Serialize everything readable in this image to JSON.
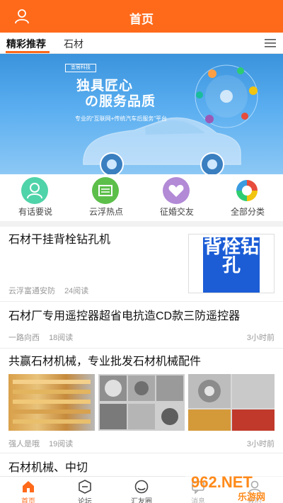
{
  "header": {
    "title": "首页",
    "user_icon": "user-icon"
  },
  "tabs": [
    {
      "label": "精彩推荐",
      "active": true
    },
    {
      "label": "石材",
      "active": false
    }
  ],
  "tabs_menu_icon": "menu-icon",
  "banner": {
    "logo_text": "宜居科技",
    "headline": "独具匠心",
    "subline": "の服务品质",
    "tagline": "专业的“互联网+传统汽车后服务”平台"
  },
  "quick_links": [
    {
      "label": "有话要说",
      "icon": "person-icon",
      "color": "#4fd3a8"
    },
    {
      "label": "云浮热点",
      "icon": "news-icon",
      "color": "#5cbf4a"
    },
    {
      "label": "征婚交友",
      "icon": "heart-handshake-icon",
      "color": "#b28ad6"
    },
    {
      "label": "全部分类",
      "icon": "swirl-icon",
      "color": "#3a9be0"
    }
  ],
  "articles": [
    {
      "title": "石材干挂背栓钻孔机",
      "author": "云浮富通安防",
      "reads": "24阅读",
      "time": "",
      "thumb_text": "背栓钻孔"
    },
    {
      "title": "石材厂专用遥控器超省电抗造CD款三防遥控器",
      "author": "一路向西",
      "reads": "18阅读",
      "time": "3小时前"
    },
    {
      "title": "共赢石材机械，专业批发石材机械配件",
      "author": "强人是哦",
      "reads": "19阅读",
      "time": "3小时前"
    },
    {
      "title": "石材机械、中切",
      "author": "",
      "reads": "",
      "time": ""
    }
  ],
  "bottom_nav": [
    {
      "label": "首页",
      "icon": "home-icon",
      "active": true
    },
    {
      "label": "论坛",
      "icon": "forum-icon",
      "active": false
    },
    {
      "label": "汇友圈",
      "icon": "circle-icon",
      "active": false
    },
    {
      "label": "消息",
      "icon": "message-icon",
      "active": false
    },
    {
      "label": "我的",
      "icon": "profile-icon",
      "active": false
    }
  ],
  "watermark": {
    "text": "962.NET",
    "subtext": "乐游网"
  },
  "colors": {
    "accent": "#ff6a1a",
    "banner_blue": "#3a93dc"
  }
}
